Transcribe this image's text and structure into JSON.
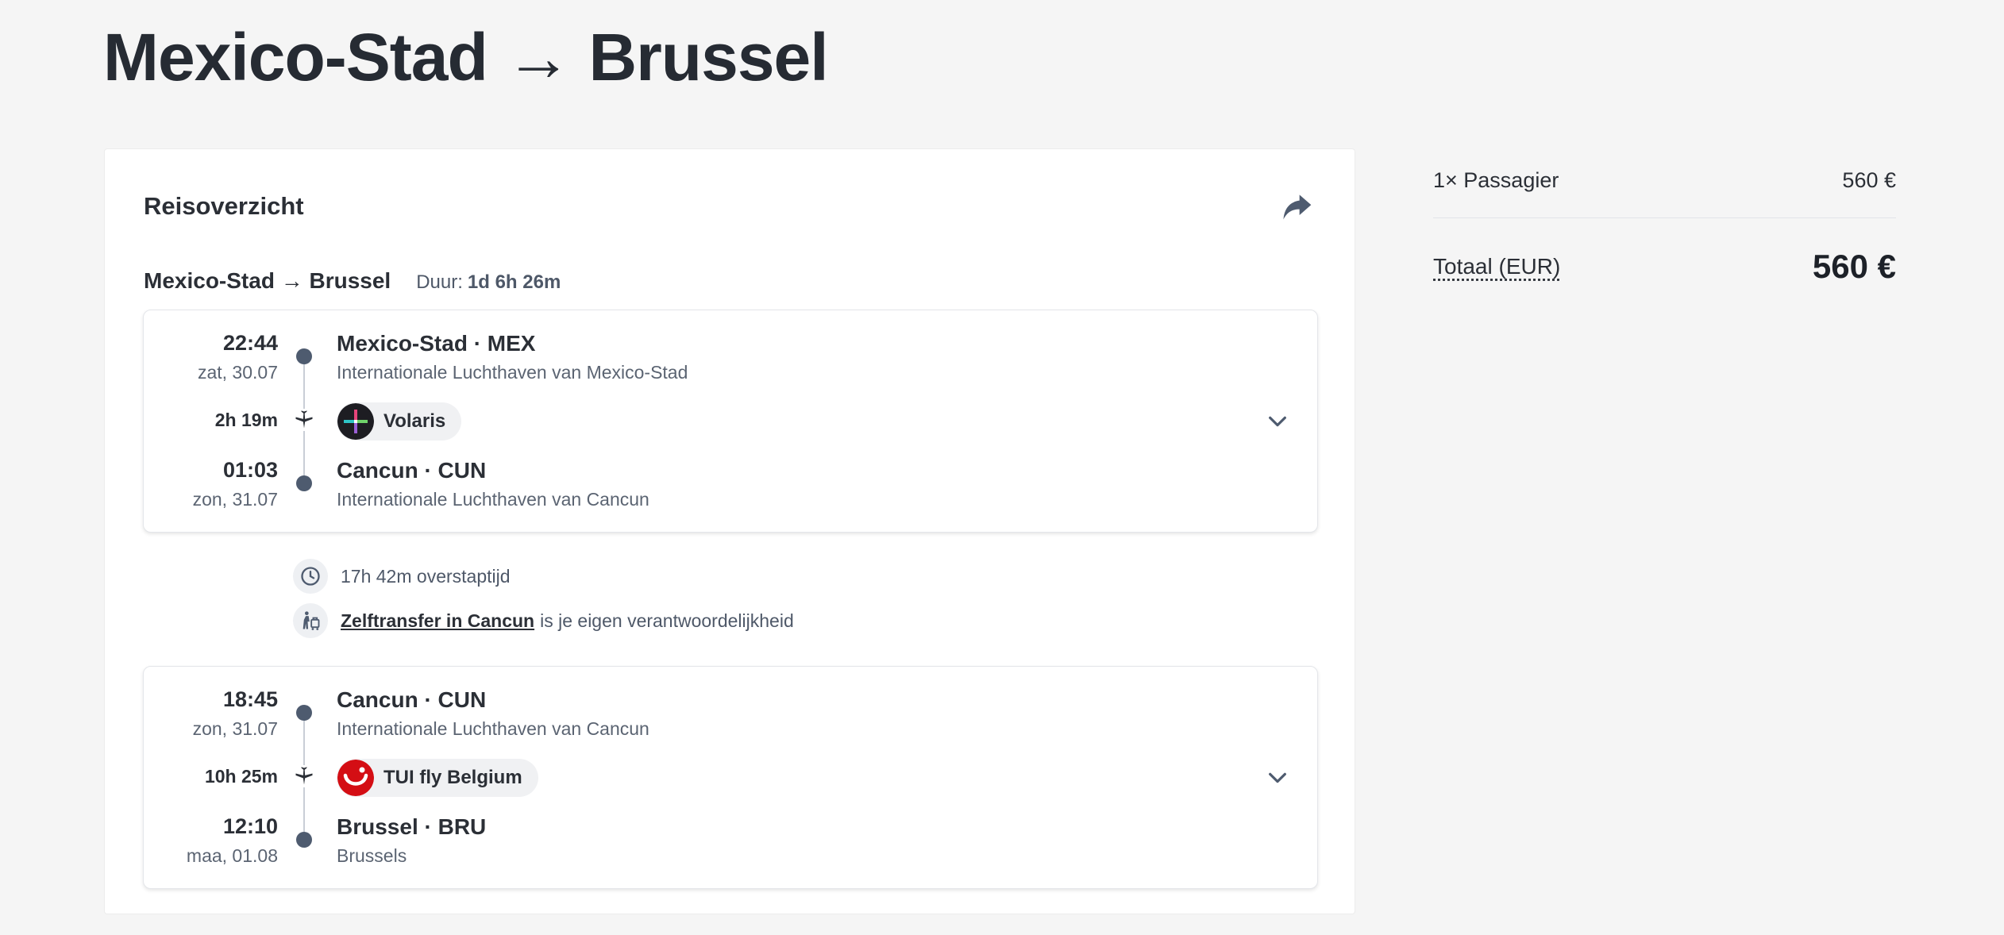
{
  "page": {
    "title": "Mexico-Stad → Brussel"
  },
  "overview": {
    "title": "Reisoverzicht",
    "route": "Mexico-Stad → Brussel",
    "duration_label": "Duur:",
    "duration_value": "1d 6h 26m",
    "share_icon": "share-icon"
  },
  "segments": [
    {
      "dep_time": "22:44",
      "dep_date": "zat, 30.07",
      "flight_duration": "2h 19m",
      "arr_time": "01:03",
      "arr_date": "zon, 31.07",
      "from_place": "Mexico-Stad · MEX",
      "from_airport": "Internationale Luchthaven van Mexico-Stad",
      "carrier": "Volaris",
      "to_place": "Cancun · CUN",
      "to_airport": "Internationale Luchthaven van Cancun"
    },
    {
      "dep_time": "18:45",
      "dep_date": "zon, 31.07",
      "flight_duration": "10h 25m",
      "arr_time": "12:10",
      "arr_date": "maa, 01.08",
      "from_place": "Cancun · CUN",
      "from_airport": "Internationale Luchthaven van Cancun",
      "carrier": "TUI fly Belgium",
      "to_place": "Brussel · BRU",
      "to_airport": "Brussels"
    }
  ],
  "layover": {
    "time_text": "17h 42m overstaptijd",
    "transfer_link": "Zelftransfer in Cancun",
    "transfer_rest": "is je eigen verantwoordelijkheid"
  },
  "pricing": {
    "passenger_label": "1× Passagier",
    "passenger_price": "560 €",
    "total_label": "Totaal (EUR)",
    "total_price": "560 €"
  },
  "colors": {
    "background": "#f5f5f5",
    "timeline_dot": "#4e5b6f",
    "tui_red": "#d40e14"
  }
}
